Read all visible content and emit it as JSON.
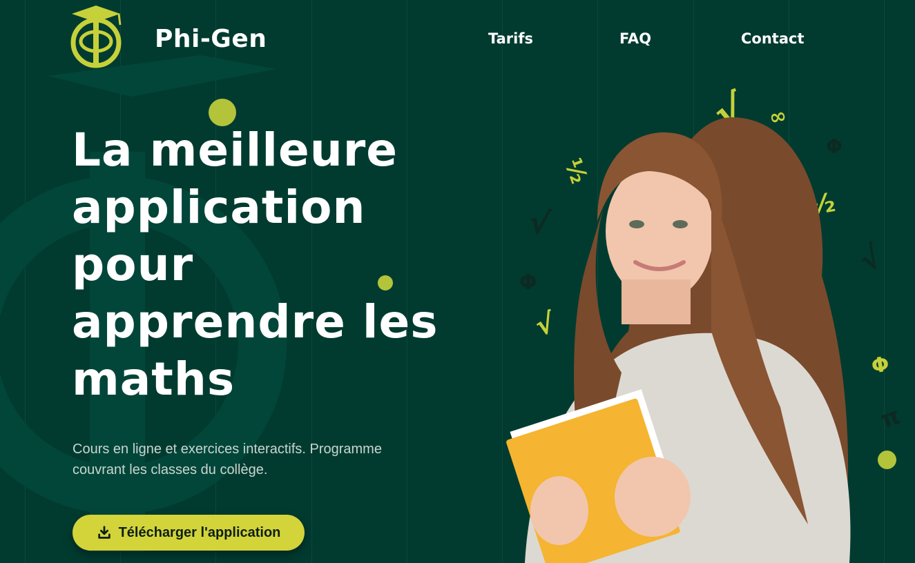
{
  "brand": {
    "name": "Phi-Gen"
  },
  "nav": {
    "items": [
      {
        "label": "Tarifs"
      },
      {
        "label": "FAQ"
      },
      {
        "label": "Contact"
      }
    ]
  },
  "hero": {
    "title_lines": [
      "La meilleure",
      "application",
      "pour",
      "apprendre les",
      "maths"
    ],
    "subtitle": "Cours en ligne et exercices interactifs. Programme couvrant les classes du collège.",
    "cta_label": "Télécharger l'application",
    "cta_icon": "download-icon"
  },
  "math_symbols": [
    "√",
    "∞",
    "Φ",
    "=",
    "½",
    "√",
    "Φ",
    "√",
    "½",
    "√",
    "Φ",
    "=",
    "π"
  ],
  "colors": {
    "background": "#013b30",
    "accent": "#d3d43a",
    "dot": "#b3c43a",
    "text": "#ffffff",
    "subtitle": "#c9d6d0"
  }
}
